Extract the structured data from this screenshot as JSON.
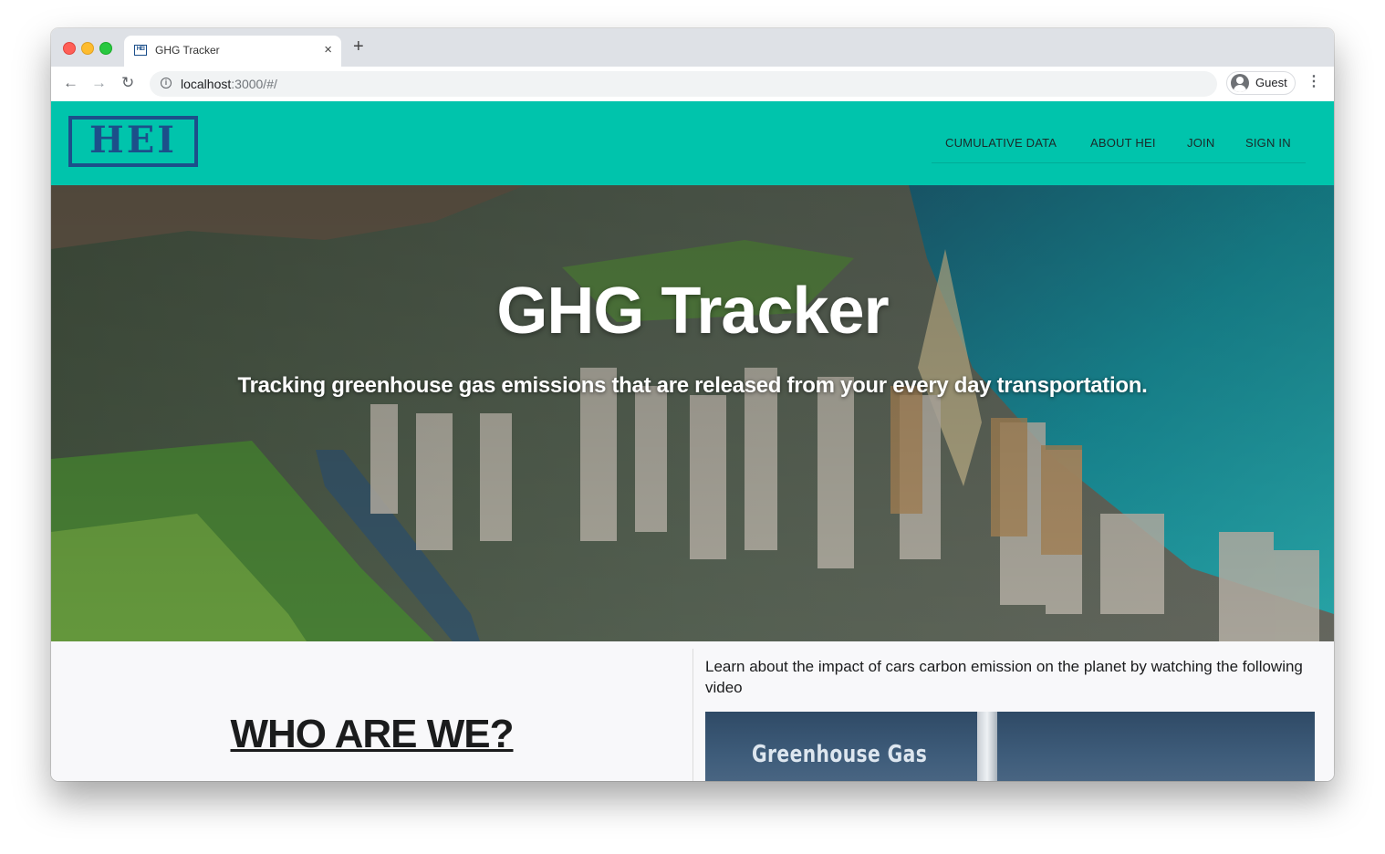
{
  "browser": {
    "tab_title": "GHG Tracker",
    "tab_favicon_text": "HEI",
    "tab_close": "×",
    "new_tab": "+",
    "url_host": "localhost",
    "url_rest": ":3000/#/",
    "profile_label": "Guest",
    "menu": "⋮",
    "back": "←",
    "forward": "→",
    "reload": "↻"
  },
  "site": {
    "logo_text": "HEI",
    "nav": [
      "CUMULATIVE DATA",
      "ABOUT HEI",
      "JOIN",
      "SIGN IN"
    ],
    "hero": {
      "title": "GHG Tracker",
      "subtitle": "Tracking greenhouse gas emissions that are released from your every day transportation."
    },
    "who_title": "WHO ARE WE?",
    "video_text": "Learn about the impact of cars carbon emission on the planet by watching the following video",
    "video_caption": "Greenhouse Gas"
  },
  "colors": {
    "nav_bg": "#00c4ac",
    "logo": "#1c4f8a",
    "page_bg": "#f8f8fa"
  }
}
